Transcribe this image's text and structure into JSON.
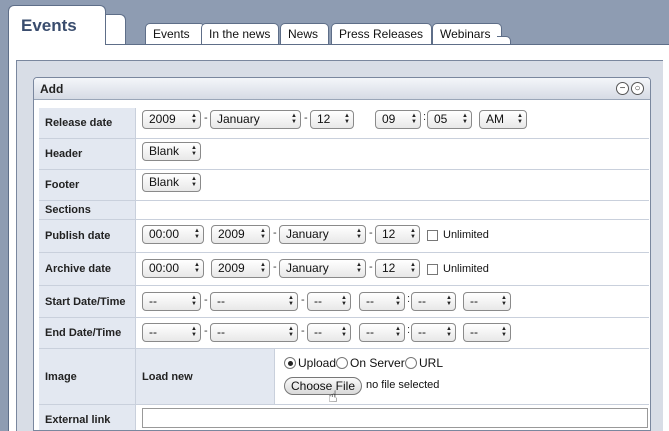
{
  "header": {
    "main_tab": "Events",
    "tabs": [
      "Events",
      "In the news",
      "News",
      "Press Releases",
      "Webinars"
    ]
  },
  "panel": {
    "title": "Add",
    "minimize_glyph": "−",
    "close_glyph": "○"
  },
  "form": {
    "release_date": {
      "label": "Release date",
      "year": "2009",
      "month": "January",
      "day": "12",
      "hour": "09",
      "minute": "05",
      "ampm": "AM"
    },
    "header_field": {
      "label": "Header",
      "value": "Blank"
    },
    "footer_field": {
      "label": "Footer",
      "value": "Blank"
    },
    "sections": {
      "label": "Sections"
    },
    "publish_date": {
      "label": "Publish date",
      "time": "00:00",
      "year": "2009",
      "month": "January",
      "day": "12",
      "unlimited": "Unlimited"
    },
    "archive_date": {
      "label": "Archive date",
      "time": "00:00",
      "year": "2009",
      "month": "January",
      "day": "12",
      "unlimited": "Unlimited"
    },
    "start_datetime": {
      "label": "Start Date/Time",
      "placeholder": "--"
    },
    "end_datetime": {
      "label": "End Date/Time",
      "placeholder": "--"
    },
    "image": {
      "label": "Image",
      "sublabel": "Load new",
      "options": [
        "Upload",
        "On Server",
        "URL"
      ],
      "choose_file": "Choose File",
      "no_file": "no file selected"
    },
    "external_link": {
      "label": "External link"
    }
  },
  "dash": "-",
  "colon": ":",
  "icons": {
    "select_arrows": "updown-arrows-icon",
    "cursor": "hand-pointer-icon"
  }
}
